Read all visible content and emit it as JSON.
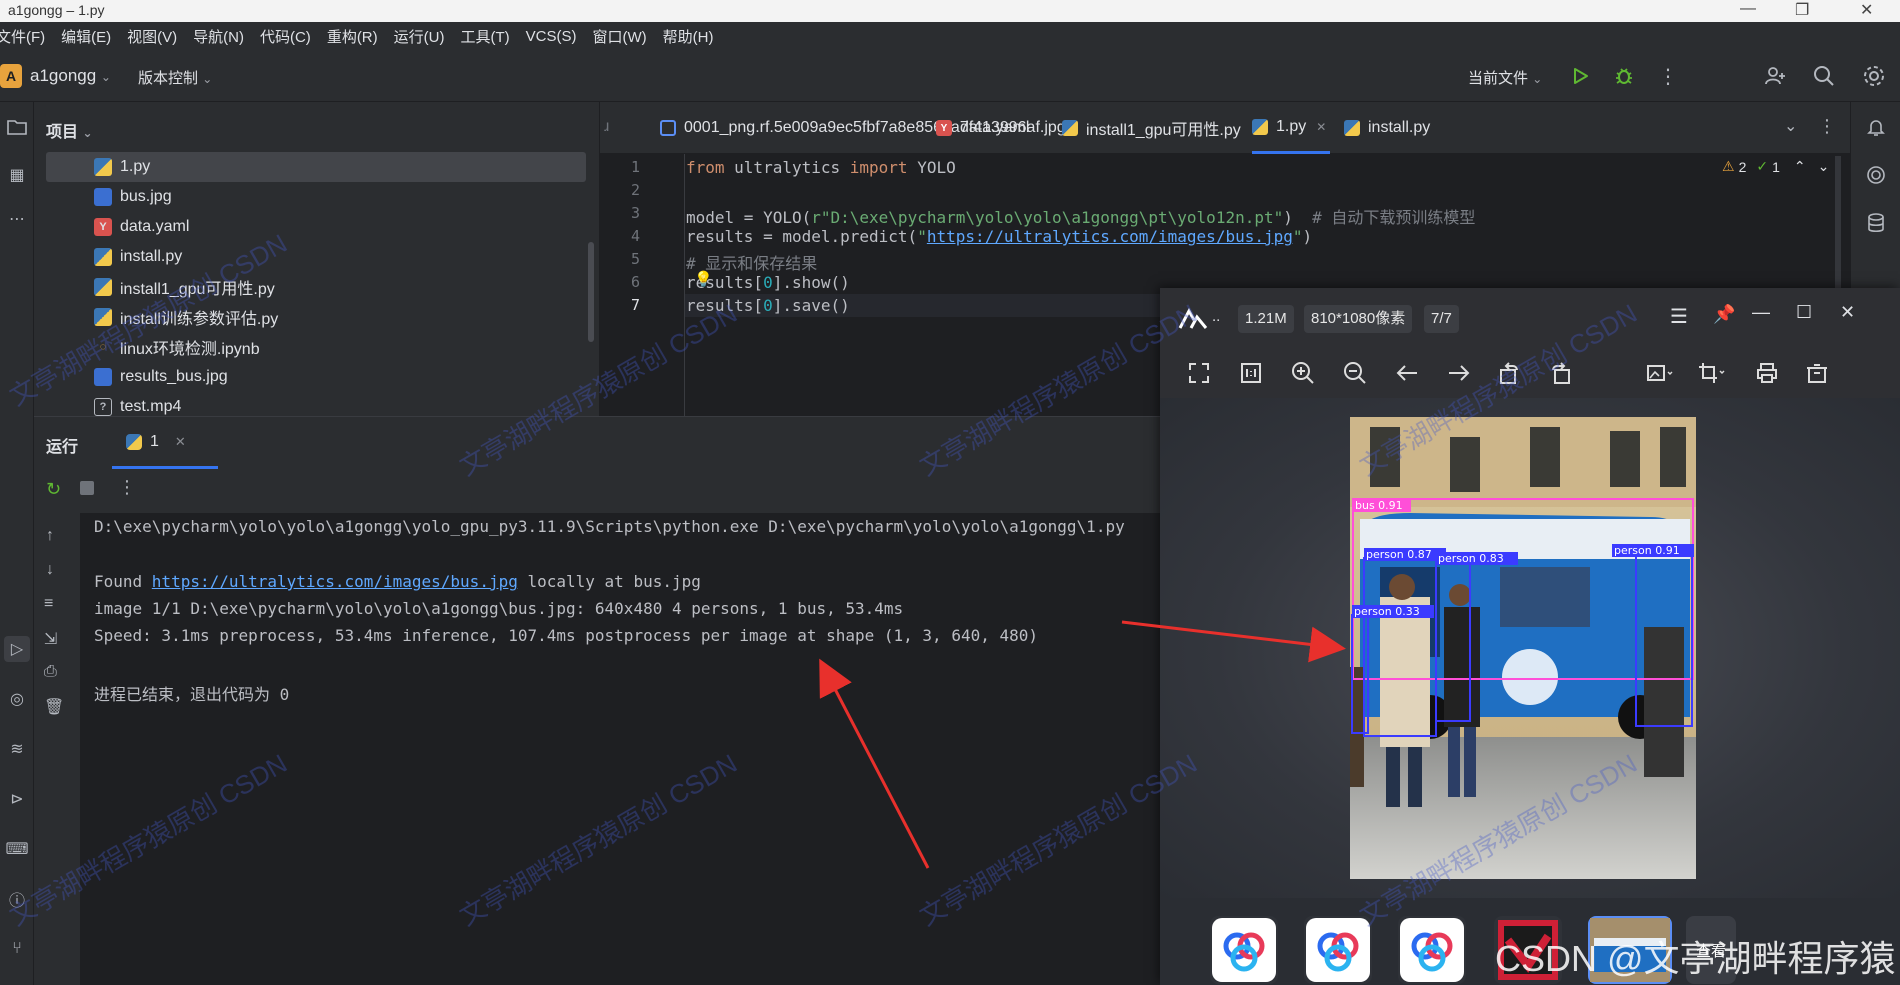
{
  "window": {
    "title": "a1gongg – 1.py"
  },
  "menu": [
    "文件(F)",
    "编辑(E)",
    "视图(V)",
    "导航(N)",
    "代码(C)",
    "重构(R)",
    "运行(U)",
    "工具(T)",
    "VCS(S)",
    "窗口(W)",
    "帮助(H)"
  ],
  "toolbar": {
    "project_badge": "A",
    "project_name": "a1gongg",
    "vcs_label": "版本控制",
    "current_file": "当前文件"
  },
  "project": {
    "title": "项目",
    "files": [
      {
        "name": "1.py",
        "type": "py"
      },
      {
        "name": "bus.jpg",
        "type": "img"
      },
      {
        "name": "data.yaml",
        "type": "yaml"
      },
      {
        "name": "install.py",
        "type": "py"
      },
      {
        "name": "install1_gpu可用性.py",
        "type": "py"
      },
      {
        "name": "install训练参数评估.py",
        "type": "py"
      },
      {
        "name": "linux环境检测.ipynb",
        "type": "nb"
      },
      {
        "name": "results_bus.jpg",
        "type": "img"
      },
      {
        "name": "test.mp4",
        "type": "vid"
      }
    ]
  },
  "editor": {
    "tabs": [
      {
        "label": "0001_png.rf.5e009a9ec5fbf7a8e856ba7f413996af.jpg",
        "type": "img"
      },
      {
        "label": "data.yaml",
        "type": "yaml"
      },
      {
        "label": "install1_gpu可用性.py",
        "type": "py"
      },
      {
        "label": "1.py",
        "type": "py",
        "active": true
      },
      {
        "label": "install.py",
        "type": "py"
      }
    ],
    "inspections": {
      "warnings": "2",
      "ok": "1"
    },
    "lines": [
      "1",
      "2",
      "3",
      "4",
      "5",
      "6",
      "7"
    ],
    "code": {
      "l1_kw1": "from",
      "l1_mod": " ultralytics ",
      "l1_kw2": "import",
      "l1_cls": " YOLO",
      "l3_a": "model = YOLO(",
      "l3_str": "r\"D:\\exe\\pycharm\\yolo\\yolo\\a1gongg\\pt\\yolo12n.pt\"",
      "l3_b": ")  ",
      "l3_cm": "# 自动下载预训练模型",
      "l4_a": "results = model.predict(",
      "l4_q1": "\"",
      "l4_link": "https://ultralytics.com/images/bus.jpg",
      "l4_q2": "\"",
      "l4_b": ")",
      "l5_cm": "# 显示和保存结果",
      "l6_a": "results[",
      "l6_n": "0",
      "l6_b": "].show()",
      "l7_a": "results[",
      "l7_n": "0",
      "l7_b": "].save()"
    }
  },
  "run": {
    "title": "运行",
    "tab": "1",
    "output": {
      "cmd": "D:\\exe\\pycharm\\yolo\\yolo\\a1gongg\\yolo_gpu_py3.11.9\\Scripts\\python.exe D:\\exe\\pycharm\\yolo\\yolo\\a1gongg\\1.py",
      "found_a": "Found ",
      "found_link": "https://ultralytics.com/images/bus.jpg",
      "found_b": " locally at bus.jpg",
      "image": "image 1/1 D:\\exe\\pycharm\\yolo\\yolo\\a1gongg\\bus.jpg: 640x480 4 persons, 1 bus, 53.4ms",
      "speed": "Speed: 3.1ms preprocess, 53.4ms inference, 107.4ms postprocess per image at shape (1, 3, 640, 480)",
      "exit": "进程已结束，退出代码为 0"
    }
  },
  "viewer": {
    "dots": "..",
    "size": "1.21M",
    "resolution": "810*1080像素",
    "index": "7/7",
    "detections": [
      {
        "label": "bus 0.91",
        "color": "#ff4fd8"
      },
      {
        "label": "person 0.87",
        "color": "#3b3bff"
      },
      {
        "label": "person 0.83",
        "color": "#3b3bff"
      },
      {
        "label": "person 0.91",
        "color": "#3b3bff"
      },
      {
        "label": "person 0.33",
        "color": "#3b3bff"
      }
    ],
    "thumb_more": "查看"
  },
  "watermark": "文亭湖畔程序猿原创 CSDN",
  "csdn": "CSDN @文亭湖畔程序猿",
  "colors": {
    "accent": "#3574f0",
    "run_green": "#5fb832",
    "arrow_red": "#e8302c"
  }
}
